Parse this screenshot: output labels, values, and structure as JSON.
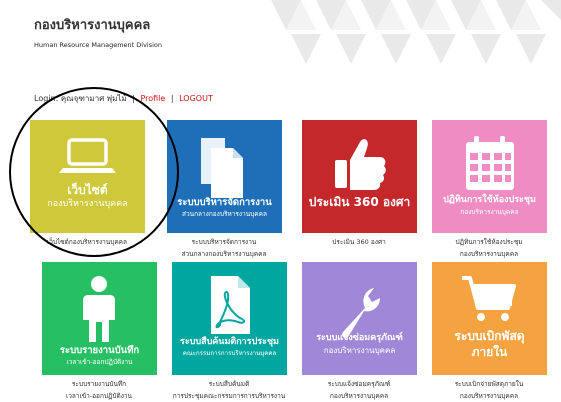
{
  "header": {
    "title": "กองบริหารงานบุคคล",
    "subtitle": "Human Resource Management Division"
  },
  "login": {
    "label": "Login:",
    "user": "คุณจุฑามาศ พุ่มไม้",
    "profile": "Profile",
    "separator": "|",
    "logout": "LOGOUT"
  },
  "tiles": [
    {
      "title": "เว็บไซต์",
      "sub": "กองบริหารงานบุคคล",
      "caption1": "เว็บไซต์กองบริหารงานบุคคล",
      "caption2": "",
      "color": "#cfc83a",
      "icon": "laptop-icon"
    },
    {
      "title": "ระบบบริหารจัดการงาน",
      "sub": "ส่วนกลางกองบริหารงานบุคคล",
      "caption1": "ระบบบริหารจัดการงาน",
      "caption2": "ส่วนกลางกองบริหารงานบุคคล",
      "color": "#1e6fb8",
      "icon": "documents-icon"
    },
    {
      "title": "ประเมิน 360 องศา",
      "sub": "",
      "caption1": "ประเมิน 360 องศา",
      "caption2": "",
      "color": "#c4282b",
      "icon": "thumbs-up-icon"
    },
    {
      "title": "ปฏิทินการใช้ห้องประชุม",
      "sub": "กองบริหารงานบุคคล",
      "caption1": "ปฏิทินการใช้ห้องประชุม",
      "caption2": "กองบริหารงานบุคคล",
      "color": "#f08cc4",
      "icon": "calendar-icon"
    },
    {
      "title": "ระบบรายงานบันทึก",
      "sub": "เวลาเข้า-ออกปฏิบัติงาน",
      "caption1": "ระบบรายงานบันทึก",
      "caption2": "เวลาเข้า-ออกปฏิบัติงาน",
      "color": "#26bf64",
      "icon": "person-icon"
    },
    {
      "title": "ระบบสืบค้นมติการประชุม",
      "sub": "คณะกรรมการการบริหารงานบุคคล",
      "caption1": "ระบบสืบค้นมติ",
      "caption2": "การประชุมคณะกรรมการการบริหารงาน",
      "color": "#00a7a0",
      "icon": "pdf-document-icon"
    },
    {
      "title": "ระบบแจ้งซ่อมครุภัณฑ์",
      "sub": "กองบริหารงานบุคคล",
      "caption1": "ระบบแจ้งซ่อมครุภัณฑ์",
      "caption2": "กองบริหารงานบุคคล",
      "color": "#a187d8",
      "icon": "wrench-icon"
    },
    {
      "title": "ระบบเบิกพัสดุ",
      "sub": "ภายใน",
      "caption1": "ระบบเบิกจ่ายพัสดุภายใน",
      "caption2": "กองบริหารงานบุคคล",
      "color": "#f5a340",
      "icon": "shopping-cart-icon"
    }
  ]
}
